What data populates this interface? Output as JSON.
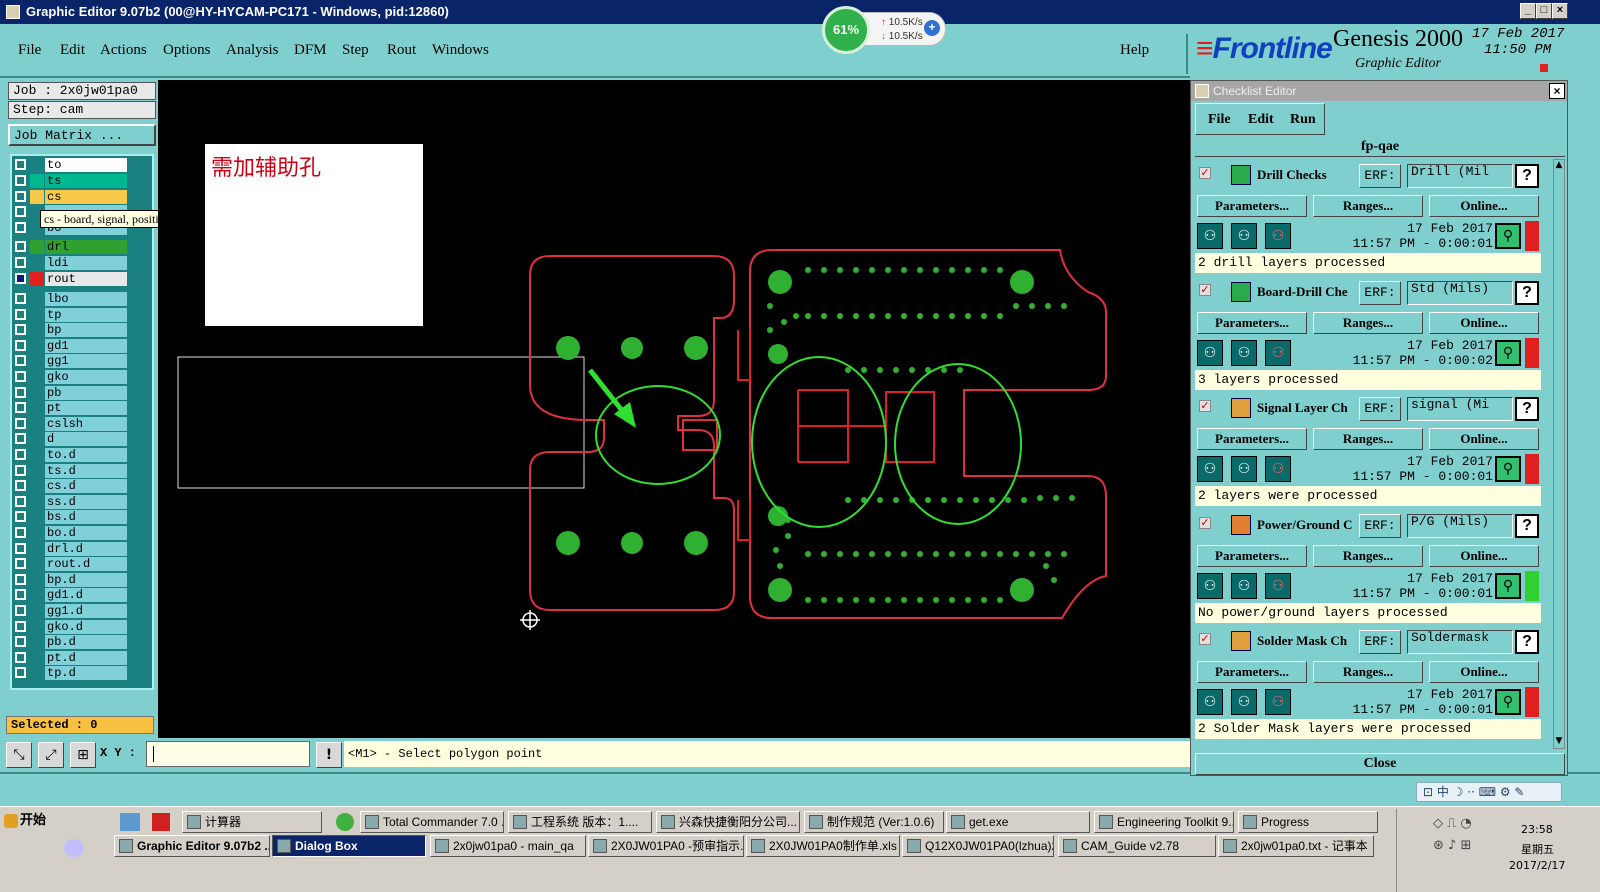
{
  "window": {
    "title": "Graphic Editor 9.07b2 (00@HY-HYCAM-PC171 - Windows, pid:12860)",
    "controls": [
      "_",
      "□",
      "×"
    ]
  },
  "menu": {
    "items": [
      "File",
      "Edit",
      "Actions",
      "Options",
      "Analysis",
      "DFM",
      "Step",
      "Rout",
      "Windows"
    ],
    "help": "Help"
  },
  "net_widget": {
    "percent": "61%",
    "up": "10.5K/s",
    "down": "10.5K/s"
  },
  "brand": {
    "logo": "Frontline",
    "product": "Genesis 2000",
    "subtitle": "Graphic Editor",
    "date": "17 Feb 2017",
    "time": "11:50 PM"
  },
  "job": {
    "job_label": "Job : 2x0jw01pa0",
    "step_label": "Step: cam",
    "matrix_button": "Job Matrix ..."
  },
  "layers": {
    "group1": [
      "to",
      "ts",
      "cs",
      "",
      "bo"
    ],
    "group2": [
      "drl",
      "ldi",
      "rout"
    ],
    "group3": [
      "lbo",
      "tp",
      "bp",
      "gd1",
      "gg1",
      "gko",
      "pb",
      "pt",
      "cslsh",
      "d",
      "to.d",
      "ts.d",
      "cs.d",
      "ss.d",
      "bs.d",
      "bo.d",
      "drl.d",
      "rout.d",
      "bp.d",
      "gd1.d",
      "gg1.d",
      "gko.d",
      "pb.d",
      "pt.d",
      "tp.d"
    ],
    "colors": {
      "ts": "#00b890",
      "cs": "#f8c848",
      "drl": "#30a030",
      "rout": "#e02020"
    }
  },
  "tooltip": "cs - board, signal, positive",
  "selected": "Selected : 0",
  "canvas": {
    "note": "需加辅助孔",
    "outline_color": "#e03040",
    "pad_color": "#30b030",
    "mark_color": "#30e030"
  },
  "status": {
    "xy_label": "X Y :",
    "xy_value": "",
    "prompt": "<M1> - Select polygon point"
  },
  "checklist": {
    "title": "Checklist Editor",
    "menu": [
      "File",
      "Edit",
      "Run"
    ],
    "name": "fp-qae",
    "checks": [
      {
        "name": "Drill Checks",
        "erf": "Drill (Mil",
        "date": "17 Feb 2017",
        "time": "11:57 PM - 0:00:01",
        "message": "2 drill layers processed",
        "status": "red"
      },
      {
        "name": "Board-Drill Che",
        "erf": "Std (Mils)",
        "date": "17 Feb 2017",
        "time": "11:57 PM - 0:00:02",
        "message": "3 layers processed",
        "status": "red"
      },
      {
        "name": "Signal Layer Ch",
        "erf": "signal (Mi",
        "date": "17 Feb 2017",
        "time": "11:57 PM - 0:00:01",
        "message": "2 layers were processed",
        "status": "red"
      },
      {
        "name": "Power/Ground C",
        "erf": "P/G (Mils)",
        "date": "17 Feb 2017",
        "time": "11:57 PM - 0:00:01",
        "message": "No power/ground layers processed",
        "status": "green"
      },
      {
        "name": "Solder Mask Ch",
        "erf": "Soldermask",
        "date": "17 Feb 2017",
        "time": "11:57 PM - 0:00:01",
        "message": "2 Solder Mask layers were processed",
        "status": "red"
      }
    ],
    "erf_label": "ERF:",
    "params_label": "Parameters...",
    "ranges_label": "Ranges...",
    "online_label": "Online...",
    "close": "Close"
  },
  "taskbar": {
    "start": "开始",
    "row1": [
      "计算器",
      "Total Commander 7.0 ...",
      "工程系统  版本：1....",
      "兴森快捷衡阳分公司...",
      "制作规范 (Ver:1.0.6)",
      "get.exe",
      "Engineering Toolkit 9....",
      "Progress"
    ],
    "row2": [
      "Graphic Editor 9.07b2 ...",
      "Dialog Box",
      "2x0jw01pa0 - main_qa",
      "2X0JW01PA0 -预审指示...",
      "2X0JW01PA0制作单.xls ...",
      "Q12X0JW01PA0(lzhua)2...",
      "CAM_Guide v2.78",
      "2x0jw01pa0.txt - 记事本"
    ],
    "clock_time": "23:58",
    "clock_day": "星期五",
    "clock_date": "2017/2/17"
  }
}
